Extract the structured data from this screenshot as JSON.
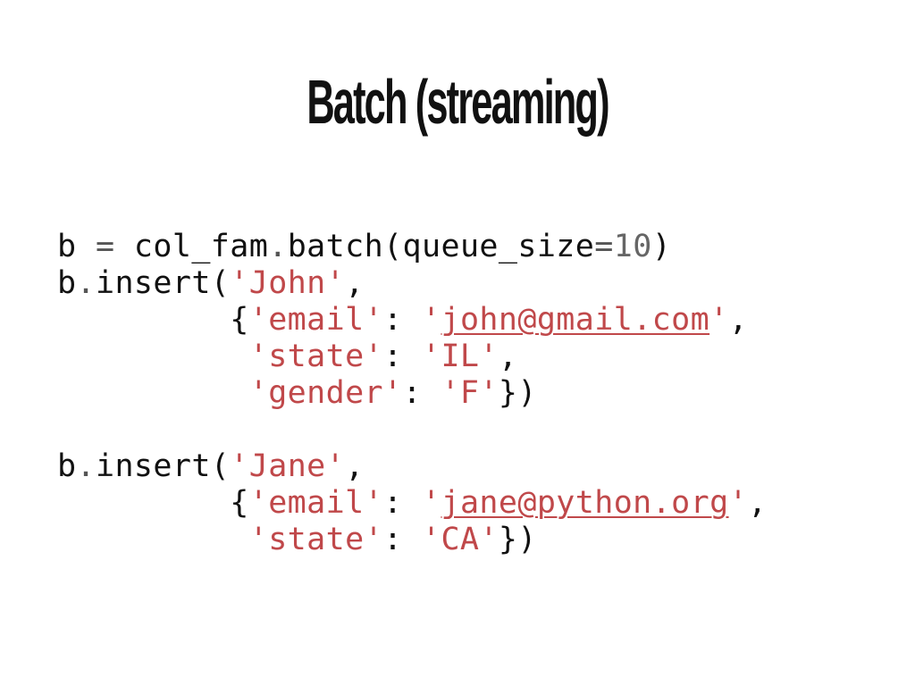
{
  "slide": {
    "title": "Batch (streaming)"
  },
  "code": {
    "lines": [
      [
        {
          "text": "b ",
          "kind": "plain"
        },
        {
          "text": "=",
          "kind": "op"
        },
        {
          "text": " col_fam",
          "kind": "plain"
        },
        {
          "text": ".",
          "kind": "op"
        },
        {
          "text": "batch(queue_size",
          "kind": "plain"
        },
        {
          "text": "=",
          "kind": "op"
        },
        {
          "text": "10",
          "kind": "num"
        },
        {
          "text": ")",
          "kind": "plain"
        }
      ],
      [
        {
          "text": "b",
          "kind": "plain"
        },
        {
          "text": ".",
          "kind": "op"
        },
        {
          "text": "insert(",
          "kind": "plain"
        },
        {
          "text": "'John'",
          "kind": "str"
        },
        {
          "text": ",",
          "kind": "plain"
        }
      ],
      [
        {
          "text": "         {",
          "kind": "plain"
        },
        {
          "text": "'email'",
          "kind": "str"
        },
        {
          "text": ": ",
          "kind": "plain"
        },
        {
          "text": "'",
          "kind": "str"
        },
        {
          "text": "john@gmail.com",
          "kind": "link"
        },
        {
          "text": "'",
          "kind": "str"
        },
        {
          "text": ",",
          "kind": "plain"
        }
      ],
      [
        {
          "text": "          ",
          "kind": "plain"
        },
        {
          "text": "'state'",
          "kind": "str"
        },
        {
          "text": ": ",
          "kind": "plain"
        },
        {
          "text": "'IL'",
          "kind": "str"
        },
        {
          "text": ",",
          "kind": "plain"
        }
      ],
      [
        {
          "text": "          ",
          "kind": "plain"
        },
        {
          "text": "'gender'",
          "kind": "str"
        },
        {
          "text": ": ",
          "kind": "plain"
        },
        {
          "text": "'F'",
          "kind": "str"
        },
        {
          "text": "})",
          "kind": "plain"
        }
      ],
      [],
      [
        {
          "text": "b",
          "kind": "plain"
        },
        {
          "text": ".",
          "kind": "op"
        },
        {
          "text": "insert(",
          "kind": "plain"
        },
        {
          "text": "'Jane'",
          "kind": "str"
        },
        {
          "text": ",",
          "kind": "plain"
        }
      ],
      [
        {
          "text": "         {",
          "kind": "plain"
        },
        {
          "text": "'email'",
          "kind": "str"
        },
        {
          "text": ": ",
          "kind": "plain"
        },
        {
          "text": "'",
          "kind": "str"
        },
        {
          "text": "jane@python.org",
          "kind": "link"
        },
        {
          "text": "'",
          "kind": "str"
        },
        {
          "text": ",",
          "kind": "plain"
        }
      ],
      [
        {
          "text": "          ",
          "kind": "plain"
        },
        {
          "text": "'state'",
          "kind": "str"
        },
        {
          "text": ": ",
          "kind": "plain"
        },
        {
          "text": "'CA'",
          "kind": "str"
        },
        {
          "text": "})",
          "kind": "plain"
        }
      ]
    ]
  },
  "colors": {
    "background": "#ffffff",
    "text": "#111111",
    "string": "#c0484a",
    "operator": "#555555",
    "number": "#666666"
  }
}
